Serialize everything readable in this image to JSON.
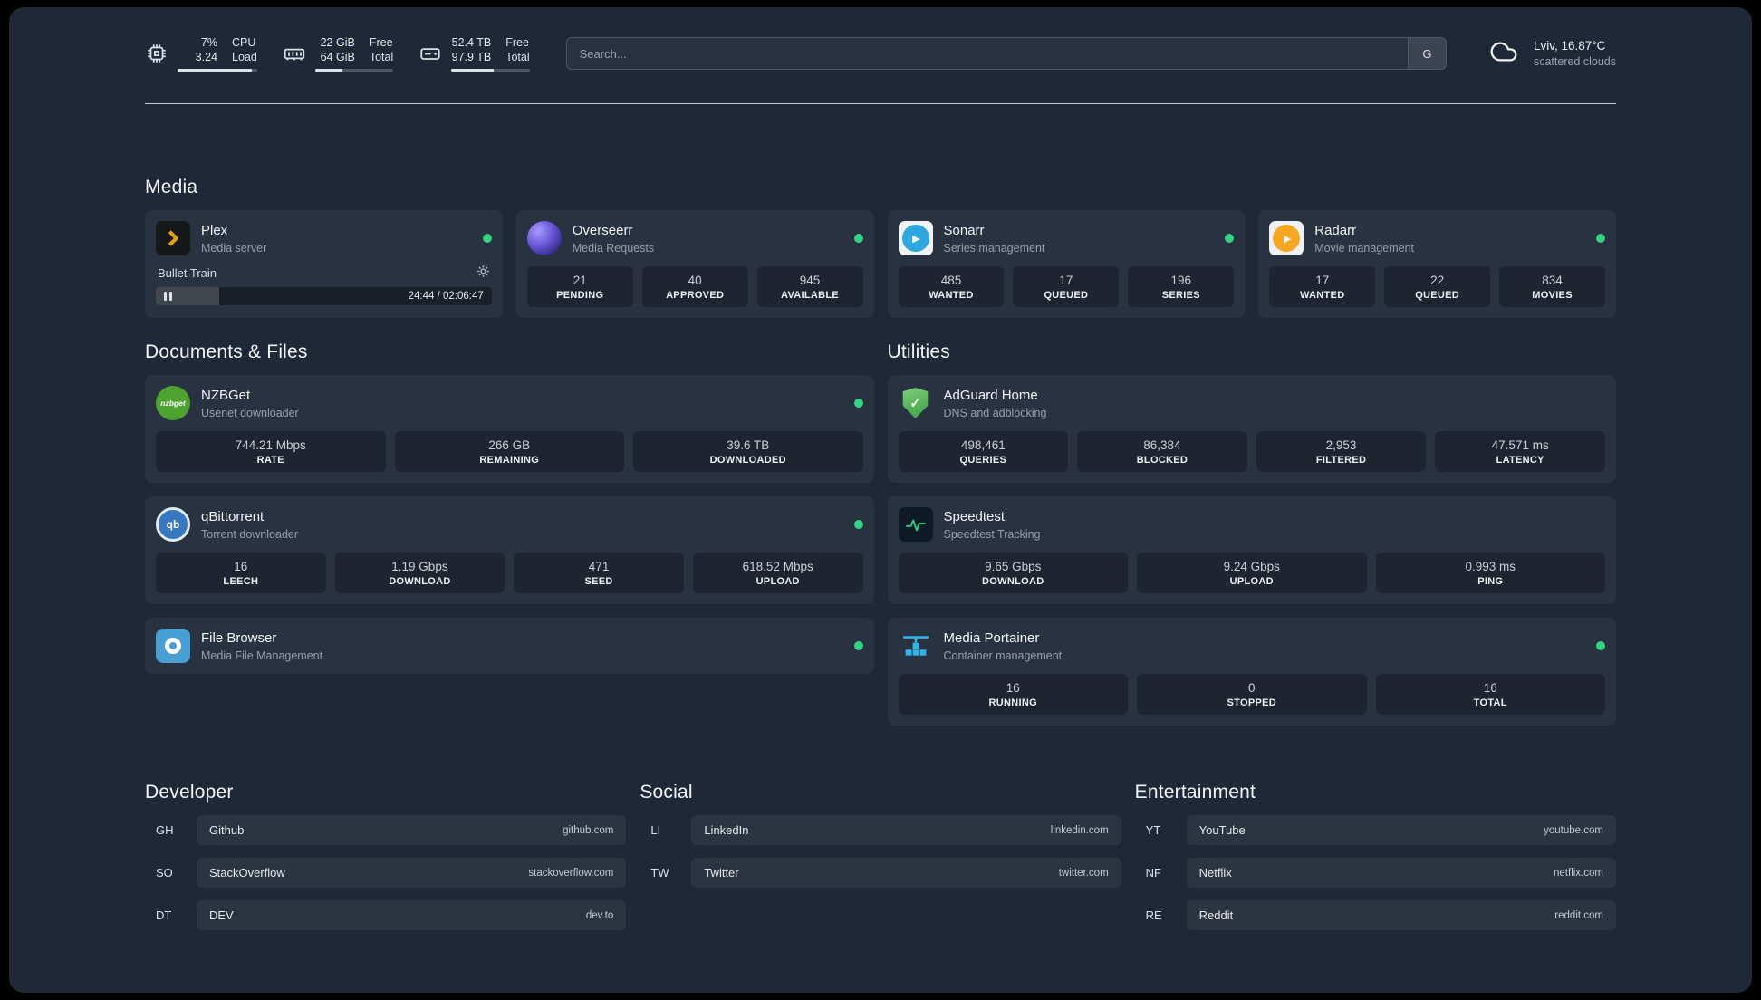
{
  "topbar": {
    "resources": [
      {
        "icon": "cpu-icon",
        "rows": [
          {
            "value": "7%",
            "label": "CPU"
          },
          {
            "value": "3.24",
            "label": "Load"
          }
        ]
      },
      {
        "icon": "memory-icon",
        "rows": [
          {
            "value": "22 GiB",
            "label": "Free"
          },
          {
            "value": "64 GiB",
            "label": "Total"
          }
        ]
      },
      {
        "icon": "disk-icon",
        "rows": [
          {
            "value": "52.4 TB",
            "label": "Free"
          },
          {
            "value": "97.9 TB",
            "label": "Total"
          }
        ]
      }
    ],
    "search": {
      "placeholder": "Search...",
      "engine_button": "G"
    },
    "weather": {
      "location": "Lviv, 16.87°C",
      "condition": "scattered clouds"
    }
  },
  "sections": {
    "media": {
      "title": "Media",
      "cards": [
        {
          "name": "Plex",
          "subtitle": "Media server",
          "status": "online",
          "player": {
            "track": "Bullet Train",
            "time": "24:44 / 02:06:47",
            "progress_percent": 19
          }
        },
        {
          "name": "Overseerr",
          "subtitle": "Media Requests",
          "status": "online",
          "stats": [
            {
              "value": "21",
              "label": "PENDING"
            },
            {
              "value": "40",
              "label": "APPROVED"
            },
            {
              "value": "945",
              "label": "AVAILABLE"
            }
          ]
        },
        {
          "name": "Sonarr",
          "subtitle": "Series management",
          "status": "online",
          "stats": [
            {
              "value": "485",
              "label": "WANTED"
            },
            {
              "value": "17",
              "label": "QUEUED"
            },
            {
              "value": "196",
              "label": "SERIES"
            }
          ]
        },
        {
          "name": "Radarr",
          "subtitle": "Movie management",
          "status": "online",
          "stats": [
            {
              "value": "17",
              "label": "WANTED"
            },
            {
              "value": "22",
              "label": "QUEUED"
            },
            {
              "value": "834",
              "label": "MOVIES"
            }
          ]
        }
      ]
    },
    "documents": {
      "title": "Documents & Files",
      "cards": [
        {
          "name": "NZBGet",
          "subtitle": "Usenet downloader",
          "status": "online",
          "icon_text": "nzbget",
          "stats": [
            {
              "value": "744.21 Mbps",
              "label": "RATE"
            },
            {
              "value": "266 GB",
              "label": "REMAINING"
            },
            {
              "value": "39.6 TB",
              "label": "DOWNLOADED"
            }
          ]
        },
        {
          "name": "qBittorrent",
          "subtitle": "Torrent downloader",
          "status": "online",
          "icon_text": "qb",
          "stats": [
            {
              "value": "16",
              "label": "LEECH"
            },
            {
              "value": "1.19 Gbps",
              "label": "DOWNLOAD"
            },
            {
              "value": "471",
              "label": "SEED"
            },
            {
              "value": "618.52 Mbps",
              "label": "UPLOAD"
            }
          ]
        },
        {
          "name": "File Browser",
          "subtitle": "Media File Management",
          "status": "online"
        }
      ]
    },
    "utilities": {
      "title": "Utilities",
      "cards": [
        {
          "name": "AdGuard Home",
          "subtitle": "DNS and adblocking",
          "stats": [
            {
              "value": "498,461",
              "label": "QUERIES"
            },
            {
              "value": "86,384",
              "label": "BLOCKED"
            },
            {
              "value": "2,953",
              "label": "FILTERED"
            },
            {
              "value": "47.571 ms",
              "label": "LATENCY"
            }
          ]
        },
        {
          "name": "Speedtest",
          "subtitle": "Speedtest Tracking",
          "stats": [
            {
              "value": "9.65 Gbps",
              "label": "DOWNLOAD"
            },
            {
              "value": "9.24 Gbps",
              "label": "UPLOAD"
            },
            {
              "value": "0.993 ms",
              "label": "PING"
            }
          ]
        },
        {
          "name": "Media Portainer",
          "subtitle": "Container management",
          "status": "online",
          "stats": [
            {
              "value": "16",
              "label": "RUNNING"
            },
            {
              "value": "0",
              "label": "STOPPED"
            },
            {
              "value": "16",
              "label": "TOTAL"
            }
          ]
        }
      ]
    }
  },
  "bookmarks": [
    {
      "title": "Developer",
      "items": [
        {
          "abbr": "GH",
          "name": "Github",
          "url": "github.com"
        },
        {
          "abbr": "SO",
          "name": "StackOverflow",
          "url": "stackoverflow.com"
        },
        {
          "abbr": "DT",
          "name": "DEV",
          "url": "dev.to"
        }
      ]
    },
    {
      "title": "Social",
      "items": [
        {
          "abbr": "LI",
          "name": "LinkedIn",
          "url": "linkedin.com"
        },
        {
          "abbr": "TW",
          "name": "Twitter",
          "url": "twitter.com"
        }
      ]
    },
    {
      "title": "Entertainment",
      "items": [
        {
          "abbr": "YT",
          "name": "YouTube",
          "url": "youtube.com"
        },
        {
          "abbr": "NF",
          "name": "Netflix",
          "url": "netflix.com"
        },
        {
          "abbr": "RE",
          "name": "Reddit",
          "url": "reddit.com"
        }
      ]
    }
  ],
  "colors": {
    "background": "#1e2836",
    "status_online": "#31d483",
    "accent_blue": "#2eb5e9",
    "plex_amber": "#e5a00d"
  }
}
